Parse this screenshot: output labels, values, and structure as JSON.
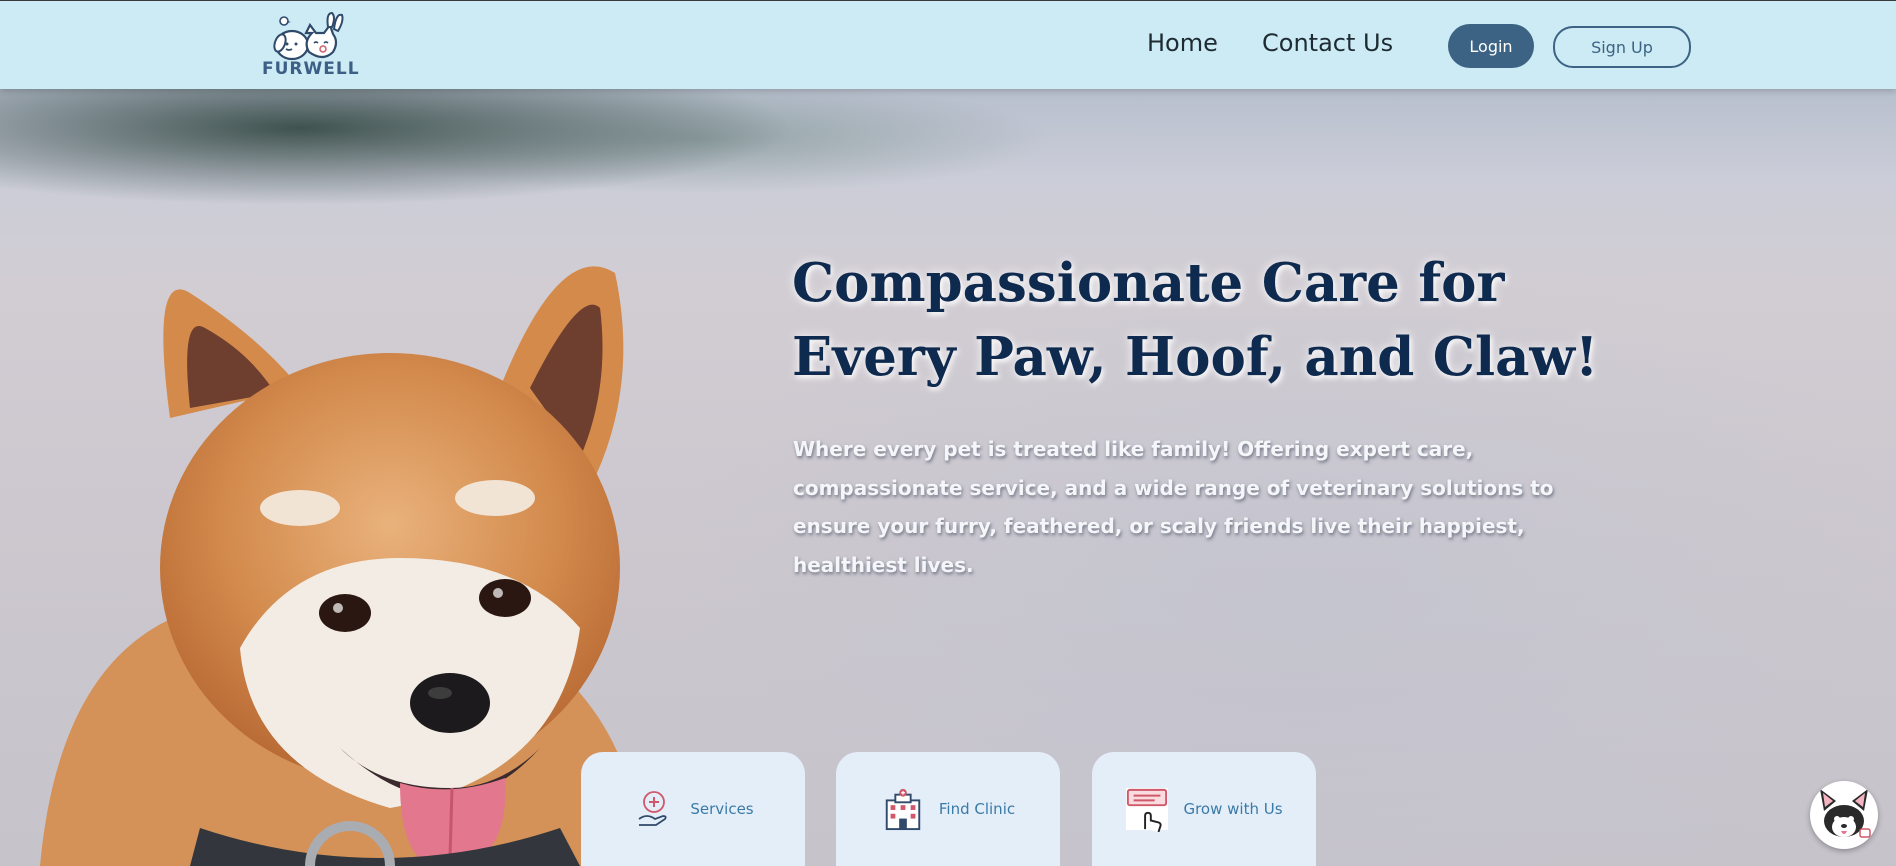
{
  "brand": {
    "logo_text": "FURWELL"
  },
  "nav": {
    "home_label": "Home",
    "contact_label": "Contact Us",
    "login_label": "Login",
    "signup_label": "Sign Up"
  },
  "hero": {
    "title_line1": "Compassionate Care for",
    "title_line2": "Every Paw, Hoof, and Claw!",
    "description": "Where every pet is treated like family! Offering expert care, compassionate service, and a wide range of veterinary solutions to ensure your furry, feathered, or scaly friends live their happiest, healthiest lives."
  },
  "cards": [
    {
      "label": "Services",
      "icon": "medical-hand-icon"
    },
    {
      "label": "Find Clinic",
      "icon": "hospital-building-icon"
    },
    {
      "label": "Grow with Us",
      "icon": "click-board-icon"
    }
  ],
  "chatbot": {
    "icon": "dog-mascot-icon"
  },
  "colors": {
    "header_bg": "#cdebf5",
    "primary": "#3c6383",
    "title": "#0f2a4f",
    "card_bg": "#e4eef9",
    "card_text": "#3a7aa8"
  }
}
